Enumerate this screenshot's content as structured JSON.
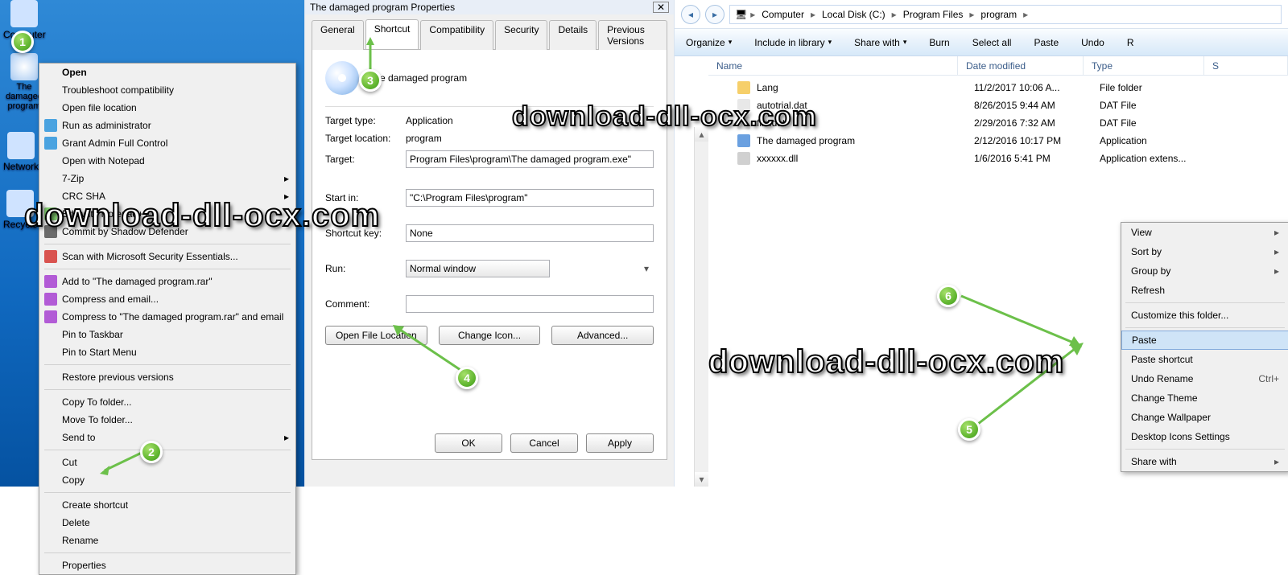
{
  "desktop": {
    "icons": [
      {
        "label": "Computer"
      },
      {
        "label": "The damaged program"
      },
      {
        "label": "Network"
      },
      {
        "label": "Recycle"
      }
    ]
  },
  "contextMenu": [
    {
      "label": "Open",
      "bold": true
    },
    {
      "label": "Troubleshoot compatibility"
    },
    {
      "label": "Open file location"
    },
    {
      "label": "Run as administrator",
      "icon": "#4aa3e0"
    },
    {
      "label": "Grant Admin Full Control",
      "icon": "#4aa3e0"
    },
    {
      "label": "Open with Notepad"
    },
    {
      "label": "7-Zip",
      "sub": true
    },
    {
      "label": "CRC SHA",
      "sub": true
    },
    {
      "label": "Edit with Notepad++",
      "icon": "#7fc96e"
    },
    {
      "label": "Commit by Shadow Defender",
      "icon": "#6b6b6b"
    },
    {
      "sep": true
    },
    {
      "label": "Scan with Microsoft Security Essentials...",
      "icon": "#d9534f"
    },
    {
      "sep": true
    },
    {
      "label": "Add to \"The damaged program.rar\"",
      "icon": "#b25bd6"
    },
    {
      "label": "Compress and email...",
      "icon": "#b25bd6"
    },
    {
      "label": "Compress to \"The damaged program.rar\" and email",
      "icon": "#b25bd6"
    },
    {
      "label": "Pin to Taskbar"
    },
    {
      "label": "Pin to Start Menu"
    },
    {
      "sep": true
    },
    {
      "label": "Restore previous versions"
    },
    {
      "sep": true
    },
    {
      "label": "Copy To folder..."
    },
    {
      "label": "Move To folder..."
    },
    {
      "label": "Send to",
      "sub": true
    },
    {
      "sep": true
    },
    {
      "label": "Cut"
    },
    {
      "label": "Copy"
    },
    {
      "sep": true
    },
    {
      "label": "Create shortcut"
    },
    {
      "label": "Delete"
    },
    {
      "label": "Rename"
    },
    {
      "sep": true
    },
    {
      "label": "Properties"
    }
  ],
  "dialog": {
    "title": "The damaged program Properties",
    "tabs": [
      "General",
      "Shortcut",
      "Compatibility",
      "Security",
      "Details",
      "Previous Versions"
    ],
    "activeTab": 1,
    "programName": "The damaged program",
    "targetTypeLabel": "Target type:",
    "targetType": "Application",
    "targetLocLabel": "Target location:",
    "targetLoc": "program",
    "targetLabel": "Target:",
    "target": "Program Files\\program\\The damaged program.exe\"",
    "startInLabel": "Start in:",
    "startIn": "\"C:\\Program Files\\program\"",
    "shortcutKeyLabel": "Shortcut key:",
    "shortcutKey": "None",
    "runLabel": "Run:",
    "run": "Normal window",
    "commentLabel": "Comment:",
    "comment": "",
    "btnOpenLoc": "Open File Location",
    "btnChangeIcon": "Change Icon...",
    "btnAdvanced": "Advanced...",
    "ok": "OK",
    "cancel": "Cancel",
    "apply": "Apply"
  },
  "explorer": {
    "breadcrumb": [
      "Computer",
      "Local Disk (C:)",
      "Program Files",
      "program"
    ],
    "toolbar": [
      "Organize",
      "Include in library",
      "Share with",
      "Burn",
      "Select all",
      "Paste",
      "Undo",
      "R"
    ],
    "columns": [
      "Name",
      "Date modified",
      "Type",
      "S"
    ],
    "files": [
      {
        "name": "Lang",
        "date": "11/2/2017 10:06 A...",
        "type": "File folder",
        "icon": "#f6cf6a"
      },
      {
        "name": "autotrial.dat",
        "date": "8/26/2015 9:44 AM",
        "type": "DAT File",
        "icon": "#e8e8e8"
      },
      {
        "name": "file.dat",
        "date": "2/29/2016 7:32 AM",
        "type": "DAT File",
        "icon": "#e8e8e8"
      },
      {
        "name": "The damaged program",
        "date": "2/12/2016 10:17 PM",
        "type": "Application",
        "icon": "#6aa0e0"
      },
      {
        "name": "xxxxxx.dll",
        "date": "1/6/2016 5:41 PM",
        "type": "Application extens...",
        "icon": "#d0d0d0"
      }
    ]
  },
  "contextMenu2": [
    {
      "label": "View",
      "sub": true
    },
    {
      "label": "Sort by",
      "sub": true
    },
    {
      "label": "Group by",
      "sub": true
    },
    {
      "label": "Refresh"
    },
    {
      "sep": true
    },
    {
      "label": "Customize this folder..."
    },
    {
      "sep": true
    },
    {
      "label": "Paste",
      "hi": true
    },
    {
      "label": "Paste shortcut"
    },
    {
      "label": "Undo Rename",
      "shortcut": "Ctrl+"
    },
    {
      "label": "Change Theme"
    },
    {
      "label": "Change Wallpaper"
    },
    {
      "label": "Desktop Icons Settings"
    },
    {
      "sep": true
    },
    {
      "label": "Share with",
      "sub": true
    }
  ],
  "watermark": "download-dll-ocx.com",
  "badges": [
    "1",
    "2",
    "3",
    "4",
    "5",
    "6"
  ]
}
